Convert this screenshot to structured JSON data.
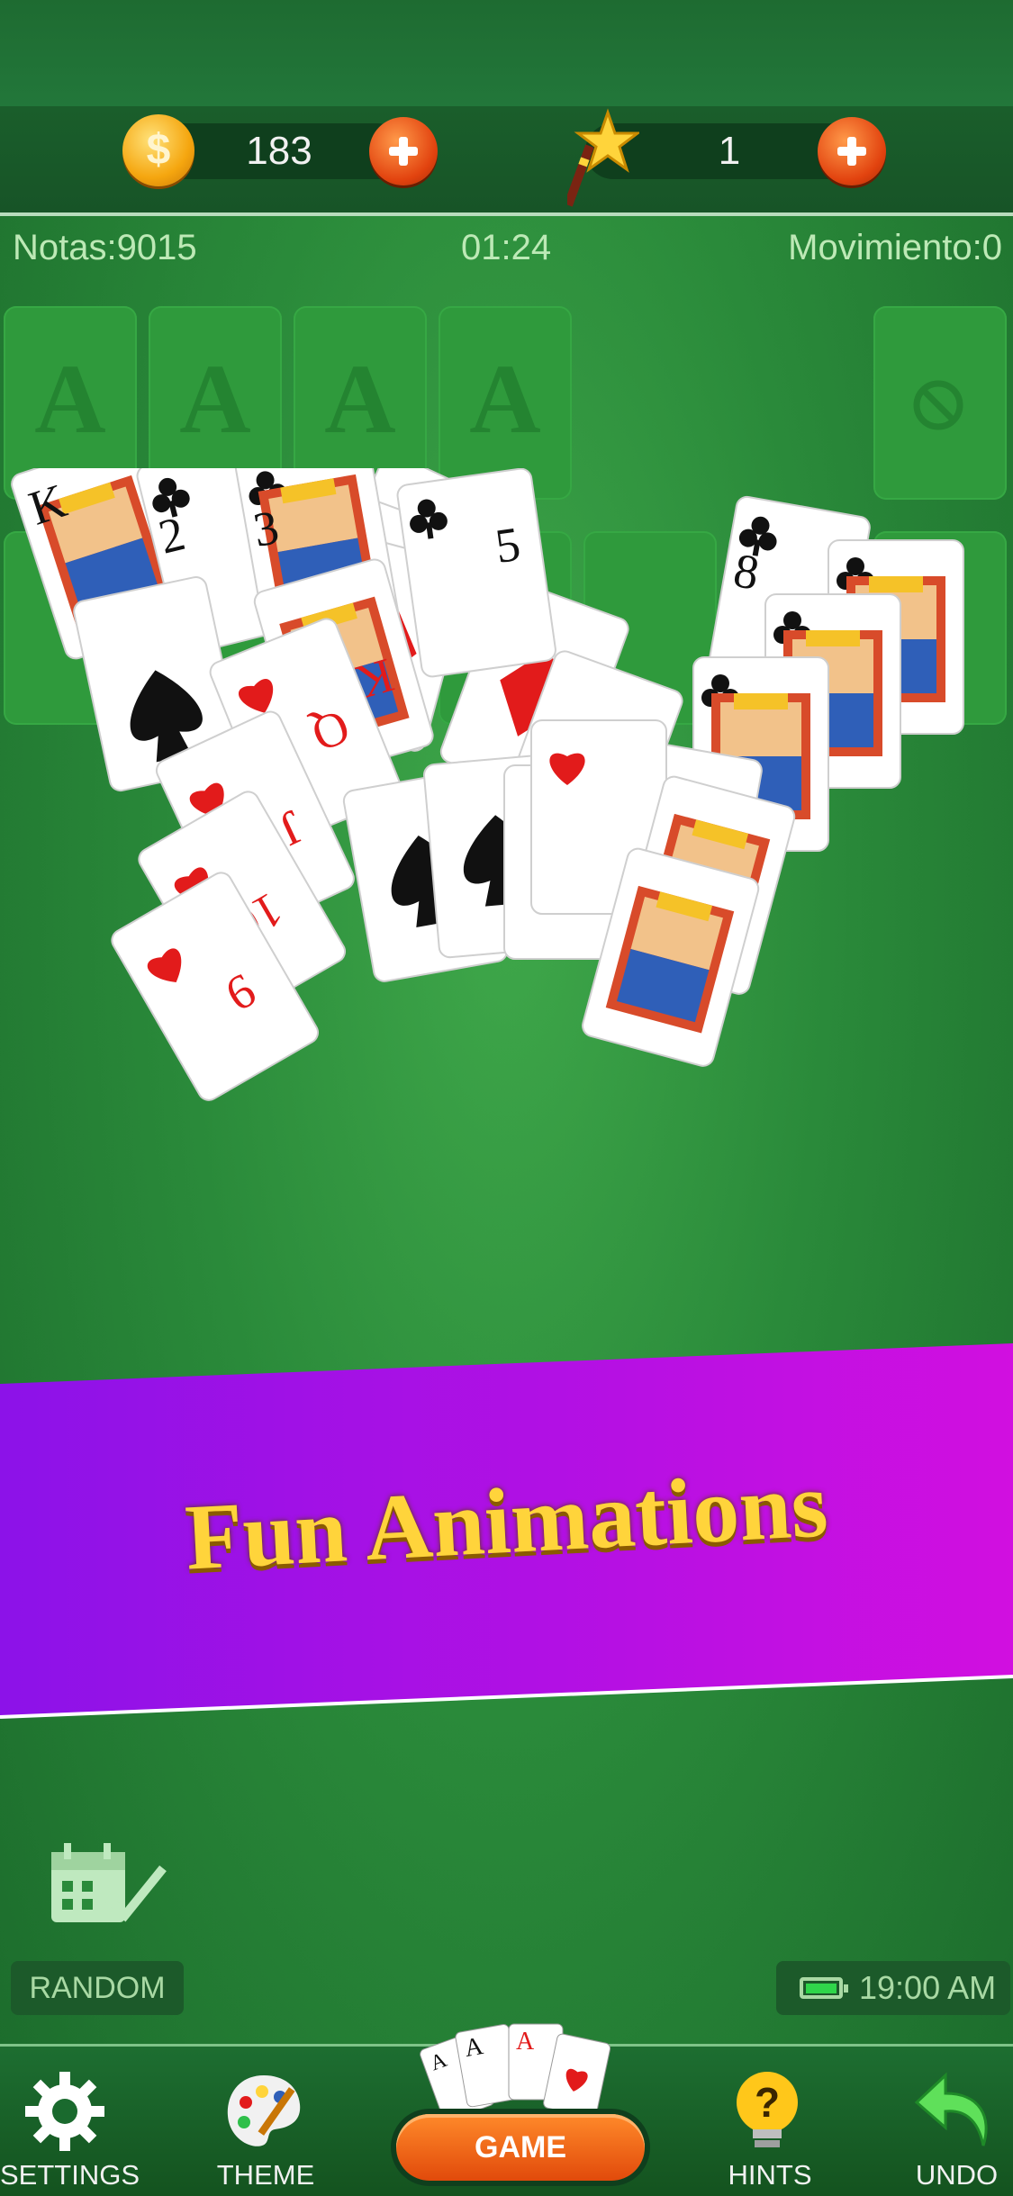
{
  "header": {
    "coins": "183",
    "wands": "1",
    "coin_symbol": "$"
  },
  "stats": {
    "score": "Notas:9015",
    "timer": "01:24",
    "moves": "Movimiento:0"
  },
  "foundations": [
    "A",
    "A",
    "A",
    "A"
  ],
  "banner": {
    "text": "Fun Animations"
  },
  "bottom": {
    "random_label": "RANDOM",
    "clock_time": "19:00 AM"
  },
  "nav": {
    "settings": "SETTINGS",
    "theme": "THEME",
    "game": "GAME",
    "hints": "HINTS",
    "undo": "UNDO"
  },
  "card_labels": [
    "K",
    "2",
    "3",
    "5",
    "8",
    "K",
    "Q",
    "J",
    "10",
    "9",
    "A"
  ],
  "colors": {
    "felt": "#2a8a3a",
    "banner_start": "#8c12e8",
    "banner_end": "#d10fe0",
    "banner_text": "#ffd43b",
    "accent_orange": "#e2430f"
  }
}
